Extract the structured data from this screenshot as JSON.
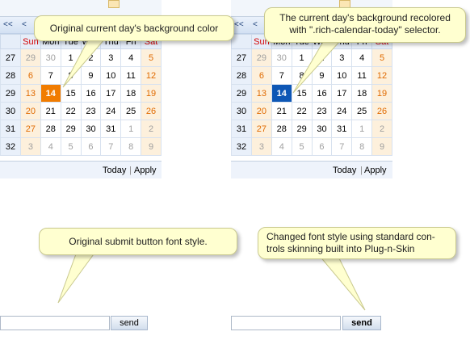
{
  "left_calendar": {
    "nav_prev_year": "<<",
    "nav_prev_month": "<",
    "weekdays": [
      "Sun",
      "Mon",
      "Tue",
      "Wed",
      "Thu",
      "Fri",
      "Sat"
    ],
    "weeks": [
      {
        "num": "27",
        "days": [
          "29",
          "30",
          "1",
          "2",
          "3",
          "4",
          "5"
        ]
      },
      {
        "num": "28",
        "days": [
          "6",
          "7",
          "8",
          "9",
          "10",
          "11",
          "12"
        ]
      },
      {
        "num": "29",
        "days": [
          "13",
          "14",
          "15",
          "16",
          "17",
          "18",
          "19"
        ]
      },
      {
        "num": "30",
        "days": [
          "20",
          "21",
          "22",
          "23",
          "24",
          "25",
          "26"
        ]
      },
      {
        "num": "31",
        "days": [
          "27",
          "28",
          "29",
          "30",
          "31",
          "1",
          "2"
        ]
      },
      {
        "num": "32",
        "days": [
          "3",
          "4",
          "5",
          "6",
          "7",
          "8",
          "9"
        ]
      }
    ],
    "today_label": "Today",
    "apply_label": "Apply"
  },
  "right_calendar": {
    "nav_prev_year": "<<",
    "nav_prev_month": "<",
    "weekdays": [
      "Sun",
      "Mon",
      "Tue",
      "Wed",
      "Thu",
      "Fri",
      "Sat"
    ],
    "weeks": [
      {
        "num": "27",
        "days": [
          "29",
          "30",
          "1",
          "2",
          "3",
          "4",
          "5"
        ]
      },
      {
        "num": "28",
        "days": [
          "6",
          "7",
          "8",
          "9",
          "10",
          "11",
          "12"
        ]
      },
      {
        "num": "29",
        "days": [
          "13",
          "14",
          "15",
          "16",
          "17",
          "18",
          "19"
        ]
      },
      {
        "num": "30",
        "days": [
          "20",
          "21",
          "22",
          "23",
          "24",
          "25",
          "26"
        ]
      },
      {
        "num": "31",
        "days": [
          "27",
          "28",
          "29",
          "30",
          "31",
          "1",
          "2"
        ]
      },
      {
        "num": "32",
        "days": [
          "3",
          "4",
          "5",
          "6",
          "7",
          "8",
          "9"
        ]
      }
    ],
    "today_label": "Today",
    "apply_label": "Apply"
  },
  "callouts": {
    "left_calendar": "Original current day's background  color",
    "right_calendar_line1": "The current day's background recolored",
    "right_calendar_line2": "with \".rich-calendar-today\"  selector.",
    "left_button": "Original submit button font style.",
    "right_button_line1": "Changed font style using standard con-",
    "right_button_line2": "trols skinning built into Plug-n-Skin"
  },
  "left_form": {
    "input_value": "",
    "button_label": "send"
  },
  "right_form": {
    "input_value": "",
    "button_label": "send"
  },
  "colors": {
    "today_original": "#f17c00",
    "today_recolored": "#0e57b5",
    "callout_bg": "#ffffd0",
    "weekend_text": "#e06a00"
  }
}
